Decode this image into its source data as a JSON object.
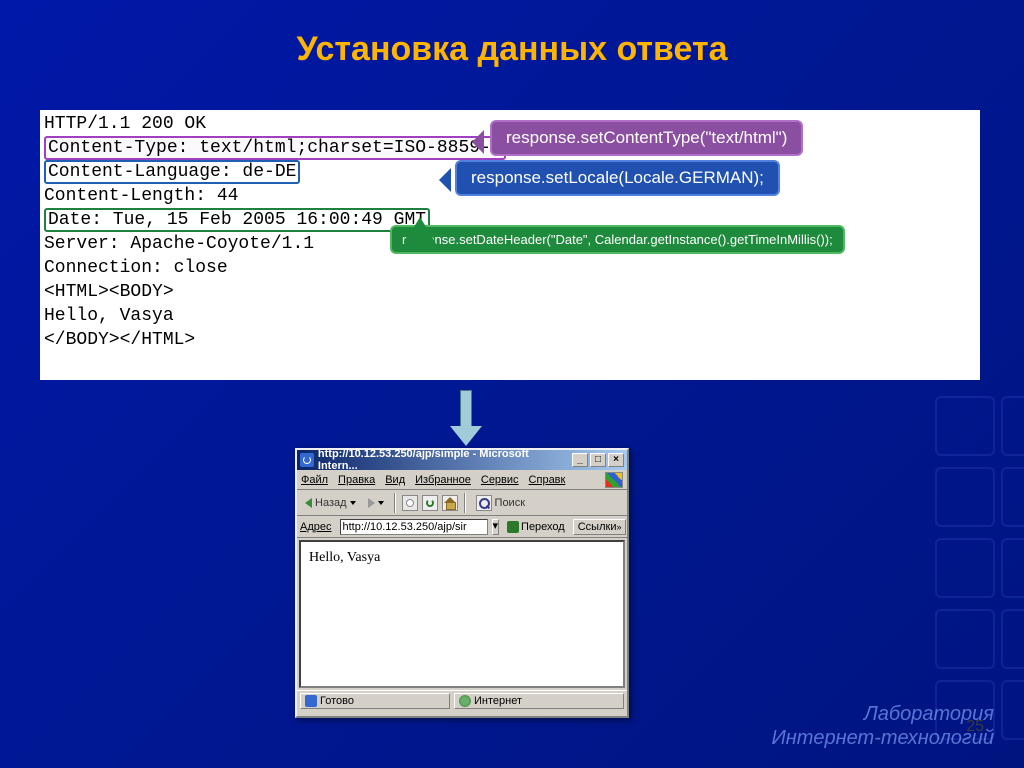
{
  "title": "Установка данных ответа",
  "code_lines": {
    "l1": "HTTP/1.1 200 OK",
    "l2": "Content-Type: text/html;charset=ISO-8859-1",
    "l3": "Content-Language: de-DE",
    "l4": "Content-Length: 44",
    "l5": "Date: Tue, 15 Feb 2005 16:00:49 GMT",
    "l6": "Server: Apache-Coyote/1.1",
    "l7": "Connection: close",
    "l8": "",
    "l9": "<HTML><BODY>",
    "l10": "Hello, Vasya",
    "l11": "</BODY></HTML>"
  },
  "callouts": {
    "purple": "response.setContentType(\"text/html\")",
    "blue": "response.setLocale(Locale.GERMAN);",
    "green": "response.setDateHeader(\"Date\",  Calendar.getInstance().getTimeInMillis());"
  },
  "browser": {
    "title": "http://10.12.53.250/ajp/simple - Microsoft Intern...",
    "menu": {
      "file": "Файл",
      "edit": "Правка",
      "view": "Вид",
      "fav": "Избранное",
      "tools": "Сервис",
      "help": "Справк"
    },
    "back": "Назад",
    "search": "Поиск",
    "addr_label": "Адрес",
    "addr_value": "http://10.12.53.250/ajp/sir",
    "go": "Переход",
    "links": "Ссылки",
    "page_text": "Hello, Vasya",
    "status_ready": "Готово",
    "status_zone": "Интернет"
  },
  "footer": {
    "line1": "Лаборатория",
    "line2": "Интернет-технологий"
  },
  "page_number": "25"
}
